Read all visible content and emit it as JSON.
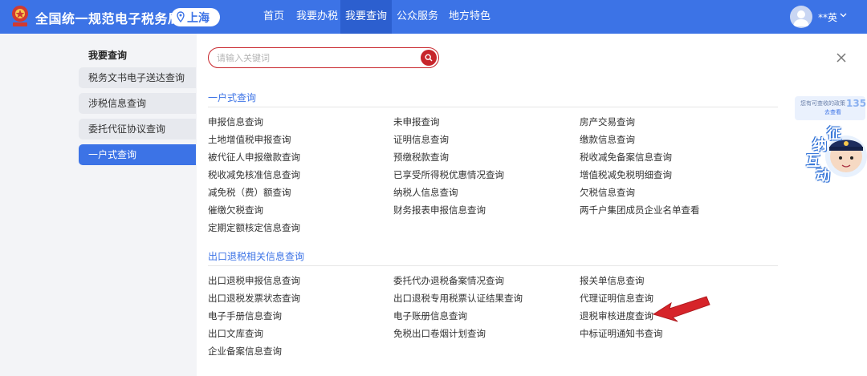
{
  "header": {
    "site_title": "全国统一规范电子税务局",
    "region": "上海",
    "nav": [
      {
        "label": "首页"
      },
      {
        "label": "我要办税"
      },
      {
        "label": "我要查询"
      },
      {
        "label": "公众服务"
      },
      {
        "label": "地方特色"
      }
    ],
    "active_nav": "我要查询",
    "user_name": "**英"
  },
  "sidebar": {
    "title": "我要查询",
    "items": [
      {
        "label": "税务文书电子送达查询"
      },
      {
        "label": "涉税信息查询"
      },
      {
        "label": "委托代征协议查询"
      },
      {
        "label": "一户式查询"
      }
    ],
    "active_item": "一户式查询"
  },
  "search": {
    "placeholder": "请输入关键词",
    "value": ""
  },
  "sections": [
    {
      "title": "一户式查询",
      "links": [
        "申报信息查询",
        "未申报查询",
        "房产交易查询",
        "土地增值税申报查询",
        "证明信息查询",
        "缴款信息查询",
        "被代征人申报缴款查询",
        "预缴税款查询",
        "税收减免备案信息查询",
        "税收减免核准信息查询",
        "已享受所得税优惠情况查询",
        "增值税减免税明细查询",
        "减免税（费）额查询",
        "纳税人信息查询",
        "欠税信息查询",
        "催缴欠税查询",
        "财务报表申报信息查询",
        "两千户集团成员企业名单查看",
        "定期定额核定信息查询"
      ]
    },
    {
      "title": "出口退税相关信息查询",
      "links": [
        "出口退税申报信息查询",
        "委托代办退税备案情况查询",
        "报关单信息查询",
        "出口退税发票状态查询",
        "出口退税专用税票认证结果查询",
        "代理证明信息查询",
        "电子手册信息查询",
        "电子账册信息查询",
        "退税审核进度查询",
        "出口文库查询",
        "免税出口卷烟计划查询",
        "中标证明通知书查询",
        "企业备案信息查询"
      ]
    }
  ],
  "float_widget": {
    "bubble_text": "您有可查收的政策",
    "bubble_link": "去查看",
    "bubble_count": "135",
    "robot_chars": [
      "征",
      "纳",
      "互",
      "动"
    ]
  },
  "colors": {
    "primary": "#3c73e6",
    "accent_red": "#c7252b",
    "sidebar_bg": "#e7e9ee"
  }
}
